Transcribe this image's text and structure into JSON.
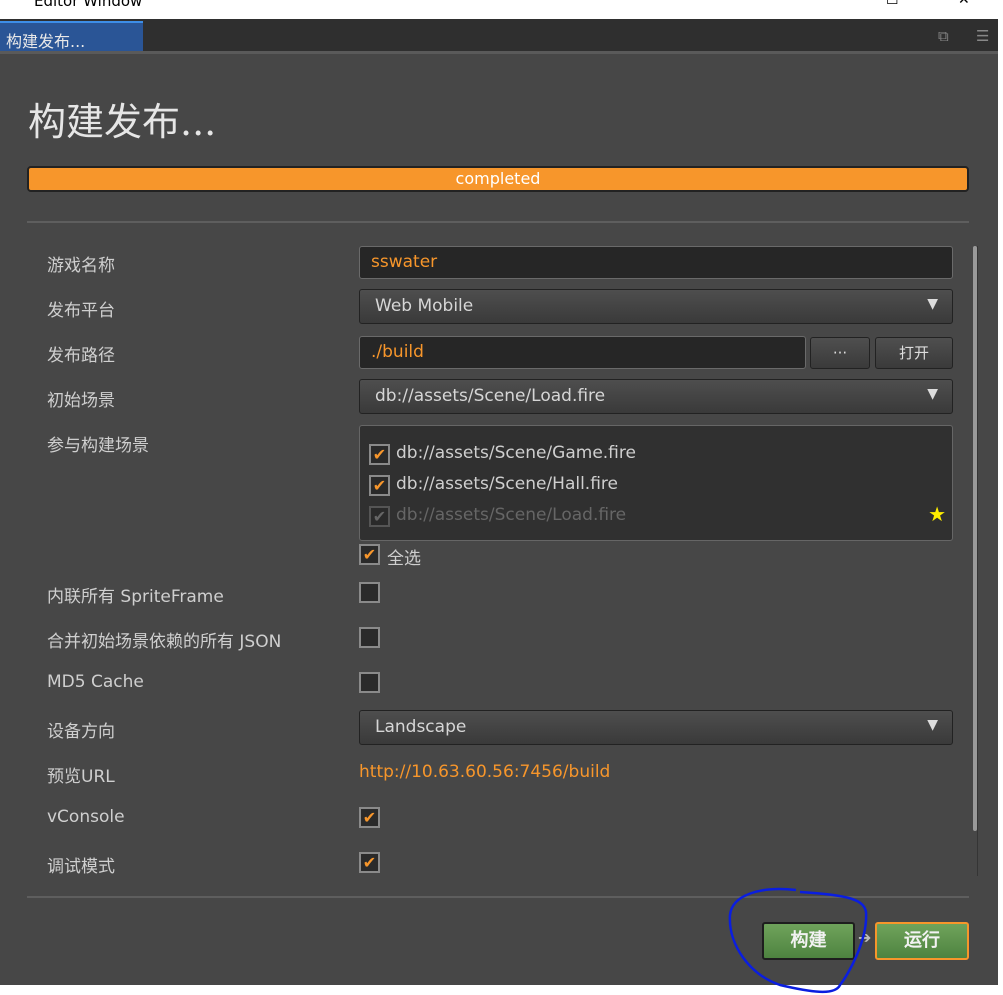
{
  "window": {
    "title": "Editor Window",
    "maximize": "☐",
    "close": "✕"
  },
  "tab": {
    "label": "构建发布...",
    "popout_icon": "popout-icon",
    "menu_icon": "menu-icon"
  },
  "heading": "构建发布...",
  "progress": {
    "label": "completed",
    "percent": 100,
    "color": "#f7962b"
  },
  "form": {
    "game_name": {
      "label": "游戏名称",
      "value": "sswater"
    },
    "platform": {
      "label": "发布平台",
      "value": "Web Mobile"
    },
    "build_path": {
      "label": "发布路径",
      "value": "./build",
      "browse": "···",
      "open": "打开"
    },
    "start_scene": {
      "label": "初始场景",
      "value": "db://assets/Scene/Load.fire"
    },
    "scenes": {
      "label": "参与构建场景",
      "items": [
        {
          "path": "db://assets/Scene/Game.fire",
          "checked": true
        },
        {
          "path": "db://assets/Scene/Hall.fire",
          "checked": true
        },
        {
          "path": "db://assets/Scene/Load.fire",
          "checked": true,
          "disabled": true,
          "start": true
        }
      ],
      "select_all": "全选"
    },
    "inline_sprite": {
      "label": "内联所有 SpriteFrame",
      "checked": false
    },
    "merge_json": {
      "label": "合并初始场景依赖的所有 JSON",
      "checked": false
    },
    "md5": {
      "label": "MD5 Cache",
      "checked": false
    },
    "orientation": {
      "label": "设备方向",
      "value": "Landscape"
    },
    "preview_url": {
      "label": "预览URL",
      "value": "http://10.63.60.56:7456/build"
    },
    "vconsole": {
      "label": "vConsole",
      "checked": true
    },
    "debug": {
      "label": "调试模式",
      "checked": true
    }
  },
  "actions": {
    "build": "构建",
    "run": "运行"
  },
  "check": "✔",
  "arrow": "▼",
  "star": "★"
}
